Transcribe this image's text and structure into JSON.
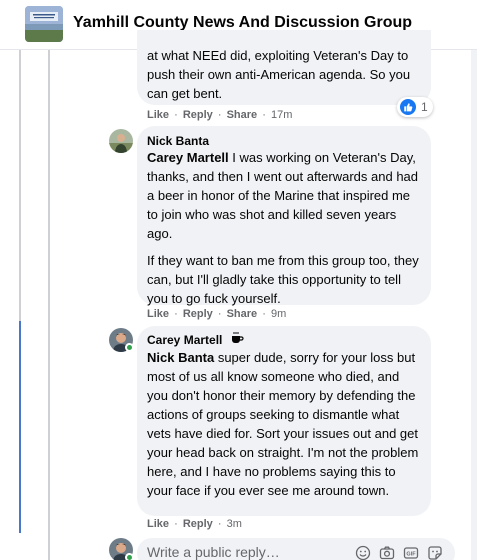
{
  "header": {
    "group_name": "Yamhill County News And Discussion Group"
  },
  "comments": [
    {
      "id": "c0",
      "text_lines": [
        "at what NEEd did, exploiting Veteran's Day to",
        "push their own anti-American agenda. So you",
        "can get bent."
      ],
      "actions": {
        "like": "Like",
        "reply": "Reply",
        "share": "Share",
        "time": "17m",
        "sep": "·"
      },
      "reaction": {
        "icon": "like-icon",
        "count": "1"
      }
    },
    {
      "id": "c1",
      "author": "Nick Banta",
      "mention": "Carey Martell",
      "paragraph1_after_mention": " I was working on Veteran's Day, thanks, and then I went out afterwards and had a beer in honor of the Marine that inspired me to join who was shot and killed seven years ago.",
      "paragraph2": "If they want to ban me from this group too, they can, but I'll gladly take this opportunity to tell you to go fuck yourself.",
      "actions": {
        "like": "Like",
        "reply": "Reply",
        "share": "Share",
        "time": "9m",
        "sep": "·"
      }
    },
    {
      "id": "c2",
      "author": "Carey Martell",
      "badge_icon": "coffee-cup-icon",
      "mention": "Nick Banta",
      "paragraph1_after_mention": " super dude, sorry for your loss but most of us all know someone who died, and you don't honor their memory by defending the actions of groups seeking to dismantle what vets have died for. Sort your issues out and get your head back on straight. I'm not the problem here, and I have no problems saying this to your face if you ever see me around town.",
      "actions": {
        "like": "Like",
        "reply": "Reply",
        "time": "3m",
        "sep": "·"
      }
    }
  ],
  "composer": {
    "placeholder": "Write a public reply…",
    "icons": [
      "emoji-icon",
      "camera-icon",
      "gif-icon",
      "sticker-icon"
    ]
  },
  "colors": {
    "facebook_blue": "#1877f2",
    "bubble_gray": "#f0f2f5",
    "secondary_text": "#65676b",
    "thread_highlight": "#4a78c8",
    "online_green": "#31a24c"
  }
}
